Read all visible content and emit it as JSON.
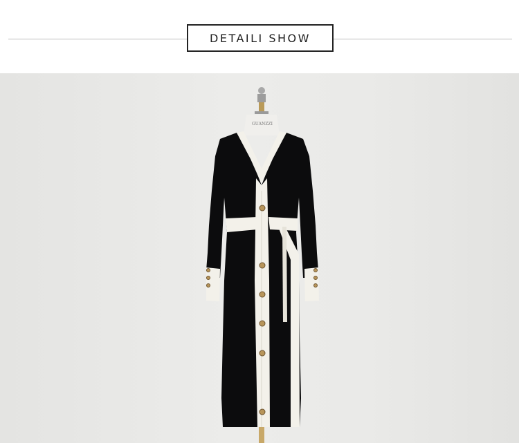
{
  "header": {
    "title": "DETAILI SHOW"
  },
  "photo": {
    "mannequin_label": "GUANZZI"
  },
  "colors": {
    "dress": "#0c0c0d",
    "trim": "#f3f1ea",
    "button": "#b8955a",
    "background": "#ebebe9"
  }
}
